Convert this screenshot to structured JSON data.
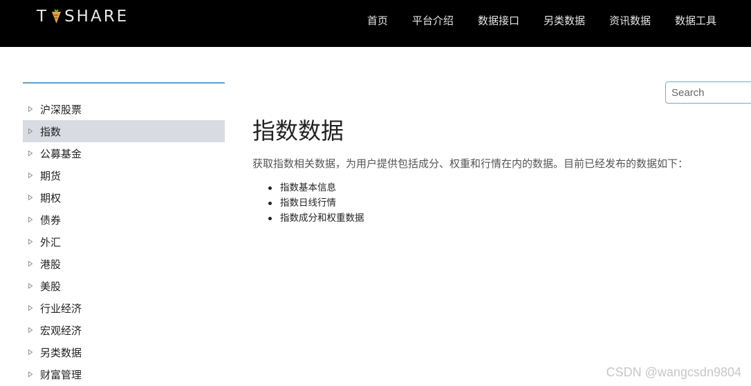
{
  "header": {
    "logo_text_left": "T",
    "logo_text_right": "SHARE",
    "nav": [
      "首页",
      "平台介绍",
      "数据接口",
      "另类数据",
      "资讯数据",
      "数据工具"
    ]
  },
  "sidebar": {
    "items": [
      {
        "label": "沪深股票",
        "active": false
      },
      {
        "label": "指数",
        "active": true
      },
      {
        "label": "公募基金",
        "active": false
      },
      {
        "label": "期货",
        "active": false
      },
      {
        "label": "期权",
        "active": false
      },
      {
        "label": "债券",
        "active": false
      },
      {
        "label": "外汇",
        "active": false
      },
      {
        "label": "港股",
        "active": false
      },
      {
        "label": "美股",
        "active": false
      },
      {
        "label": "行业经济",
        "active": false
      },
      {
        "label": "宏观经济",
        "active": false
      },
      {
        "label": "另类数据",
        "active": false
      },
      {
        "label": "财富管理",
        "active": false
      }
    ]
  },
  "search": {
    "placeholder": "Search"
  },
  "main": {
    "title": "指数数据",
    "intro": "获取指数相关数据，为用户提供包括成分、权重和行情在内的数据。目前已经发布的数据如下：",
    "bullets": [
      "指数基本信息",
      "指数日线行情",
      "指数成分和权重数据"
    ]
  },
  "watermark": "CSDN @wangcsdn9804",
  "colors": {
    "topbar": "#000000",
    "logo_accent": "#e8a33a",
    "sidebar_line": "#5b9bd5",
    "active_item_bg": "#d9dbe3"
  }
}
